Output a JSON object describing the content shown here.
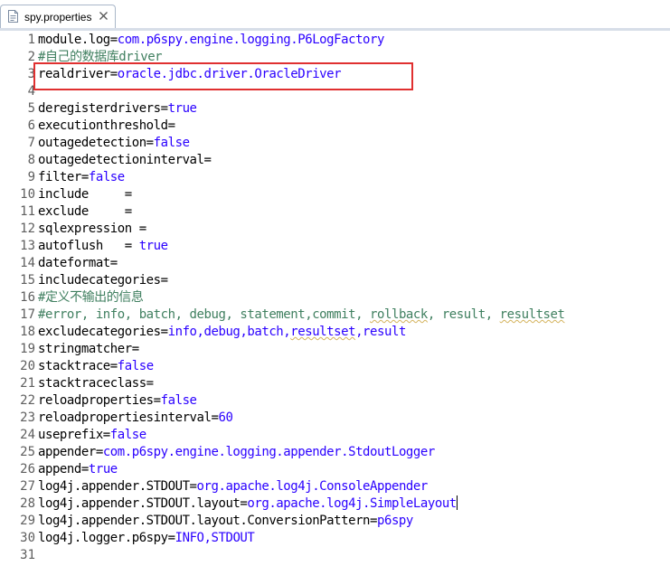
{
  "tab": {
    "label": "spy.properties",
    "icon": "properties-file-icon"
  },
  "accent": {
    "highlight_border": "#e03030",
    "value": "#2a00ff",
    "comment": "#3f7f5f"
  },
  "lines": [
    {
      "n": "1",
      "parts": [
        {
          "t": "module.log=",
          "c": "k"
        },
        {
          "t": "com.p6spy.engine.logging.P6LogFactory",
          "c": "v"
        }
      ]
    },
    {
      "n": "2",
      "parts": [
        {
          "t": "#自己的数据库driver",
          "c": "cm"
        }
      ]
    },
    {
      "n": "3",
      "parts": [
        {
          "t": "realdriver=",
          "c": "k"
        },
        {
          "t": "oracle.jdbc.driver.OracleDriver",
          "c": "v"
        }
      ]
    },
    {
      "n": "4",
      "parts": []
    },
    {
      "n": "5",
      "parts": [
        {
          "t": "deregisterdrivers=",
          "c": "k"
        },
        {
          "t": "true",
          "c": "v"
        }
      ]
    },
    {
      "n": "6",
      "parts": [
        {
          "t": "executionthreshold=",
          "c": "k"
        }
      ]
    },
    {
      "n": "7",
      "parts": [
        {
          "t": "outagedetection=",
          "c": "k"
        },
        {
          "t": "false",
          "c": "v"
        }
      ]
    },
    {
      "n": "8",
      "parts": [
        {
          "t": "outagedetectioninterval=",
          "c": "k"
        }
      ]
    },
    {
      "n": "9",
      "parts": [
        {
          "t": "filter=",
          "c": "k"
        },
        {
          "t": "false",
          "c": "v"
        }
      ]
    },
    {
      "n": "10",
      "parts": [
        {
          "t": "include     =",
          "c": "k"
        }
      ]
    },
    {
      "n": "11",
      "parts": [
        {
          "t": "exclude     =",
          "c": "k"
        }
      ]
    },
    {
      "n": "12",
      "parts": [
        {
          "t": "sqlexpression =",
          "c": "k"
        }
      ]
    },
    {
      "n": "13",
      "parts": [
        {
          "t": "autoflush   = ",
          "c": "k"
        },
        {
          "t": "true",
          "c": "v"
        }
      ]
    },
    {
      "n": "14",
      "parts": [
        {
          "t": "dateformat=",
          "c": "k"
        }
      ]
    },
    {
      "n": "15",
      "parts": [
        {
          "t": "includecategories=",
          "c": "k"
        }
      ]
    },
    {
      "n": "16",
      "parts": [
        {
          "t": "#定义不输出的信息",
          "c": "cm"
        }
      ]
    },
    {
      "n": "17",
      "parts": [
        {
          "t": "#error, info, batch, debug, statement,commit, ",
          "c": "cm"
        },
        {
          "t": "rollback",
          "c": "cm sq"
        },
        {
          "t": ", result, ",
          "c": "cm"
        },
        {
          "t": "resultset",
          "c": "cm sq"
        }
      ]
    },
    {
      "n": "18",
      "parts": [
        {
          "t": "excludecategories=",
          "c": "k"
        },
        {
          "t": "info,debug,batch,",
          "c": "v"
        },
        {
          "t": "resultset",
          "c": "v sq"
        },
        {
          "t": ",result",
          "c": "v"
        }
      ]
    },
    {
      "n": "19",
      "parts": [
        {
          "t": "stringmatcher=",
          "c": "k"
        }
      ]
    },
    {
      "n": "20",
      "parts": [
        {
          "t": "stacktrace=",
          "c": "k"
        },
        {
          "t": "false",
          "c": "v"
        }
      ]
    },
    {
      "n": "21",
      "parts": [
        {
          "t": "stacktraceclass=",
          "c": "k"
        }
      ]
    },
    {
      "n": "22",
      "parts": [
        {
          "t": "reloadproperties=",
          "c": "k"
        },
        {
          "t": "false",
          "c": "v"
        }
      ]
    },
    {
      "n": "23",
      "parts": [
        {
          "t": "reloadpropertiesinterval=",
          "c": "k"
        },
        {
          "t": "60",
          "c": "v"
        }
      ]
    },
    {
      "n": "24",
      "parts": [
        {
          "t": "useprefix=",
          "c": "k"
        },
        {
          "t": "false",
          "c": "v"
        }
      ]
    },
    {
      "n": "25",
      "parts": [
        {
          "t": "appender=",
          "c": "k"
        },
        {
          "t": "com.p6spy.engine.logging.appender.StdoutLogger",
          "c": "v"
        }
      ]
    },
    {
      "n": "26",
      "parts": [
        {
          "t": "append=",
          "c": "k"
        },
        {
          "t": "true",
          "c": "v"
        }
      ]
    },
    {
      "n": "27",
      "parts": [
        {
          "t": "log4j.appender.STDOUT=",
          "c": "k"
        },
        {
          "t": "org.apache.log4j.ConsoleAppender",
          "c": "v"
        }
      ]
    },
    {
      "n": "28",
      "parts": [
        {
          "t": "log4j.appender.STDOUT.layout=",
          "c": "k"
        },
        {
          "t": "org.apache.log4j.SimpleLayout",
          "c": "v"
        }
      ],
      "caret": true
    },
    {
      "n": "29",
      "parts": [
        {
          "t": "log4j.appender.STDOUT.layout.ConversionPattern=",
          "c": "k"
        },
        {
          "t": "p6spy",
          "c": "v"
        }
      ]
    },
    {
      "n": "30",
      "parts": [
        {
          "t": "log4j.logger.p6spy=",
          "c": "k"
        },
        {
          "t": "INFO,STDOUT",
          "c": "v"
        }
      ]
    },
    {
      "n": "31",
      "parts": []
    }
  ]
}
